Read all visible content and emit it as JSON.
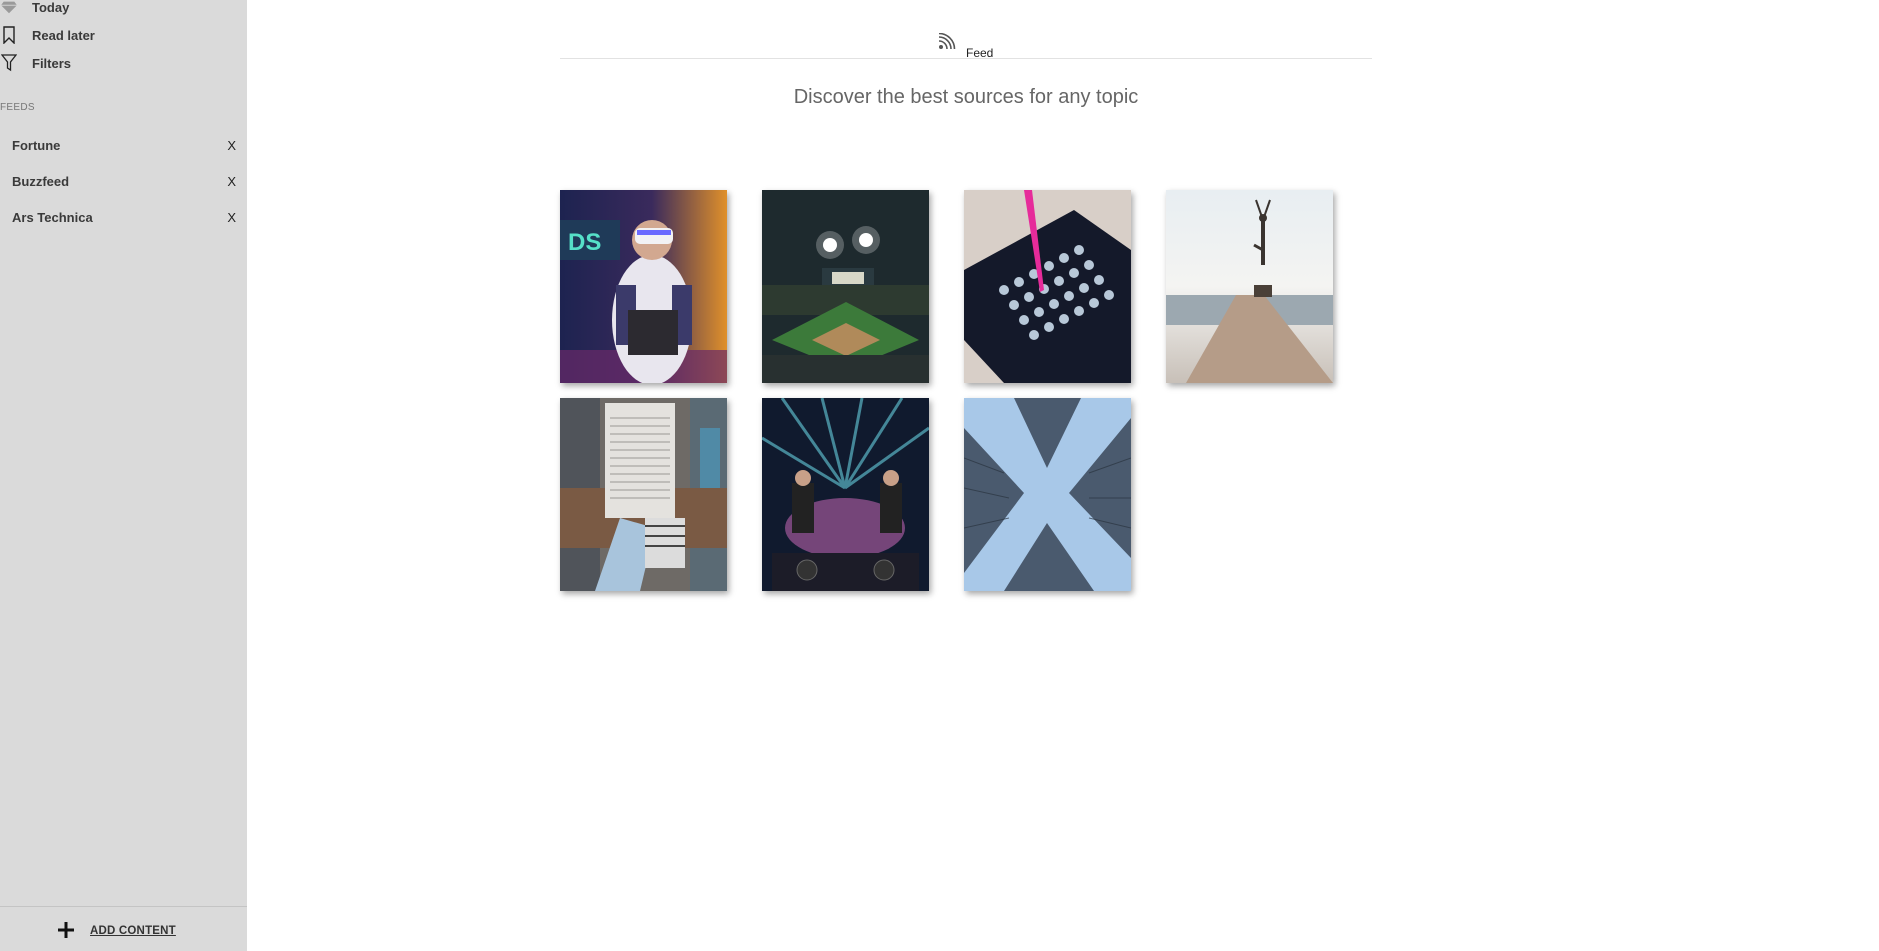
{
  "sidebar": {
    "nav": [
      {
        "label": "Today",
        "icon": "gem-icon"
      },
      {
        "label": "Read later",
        "icon": "bookmark-icon"
      },
      {
        "label": "Filters",
        "icon": "filter-icon"
      }
    ],
    "feeds_heading": "FEEDS",
    "feeds": [
      {
        "name": "Fortune",
        "remove": "X"
      },
      {
        "name": "Buzzfeed",
        "remove": "X"
      },
      {
        "name": "Ars Technica",
        "remove": "X"
      }
    ],
    "add_content": {
      "icon": "plus-icon",
      "label": "ADD CONTENT"
    }
  },
  "header": {
    "tab_label": "Feed",
    "tab_icon": "rss-icon"
  },
  "main": {
    "tagline": "Discover the best sources for any topic",
    "tiles": [
      {
        "topic": "vr-headset-photo"
      },
      {
        "topic": "baseball-stadium-photo"
      },
      {
        "topic": "lab-pipette-photo"
      },
      {
        "topic": "yoga-pier-photo"
      },
      {
        "topic": "newspaper-reader-photo"
      },
      {
        "topic": "concert-dj-photo"
      },
      {
        "topic": "skyscrapers-photo"
      }
    ]
  },
  "colors": {
    "sidebar_bg": "#dadada",
    "page_bg": "#ffffff",
    "tagline": "#666666"
  }
}
